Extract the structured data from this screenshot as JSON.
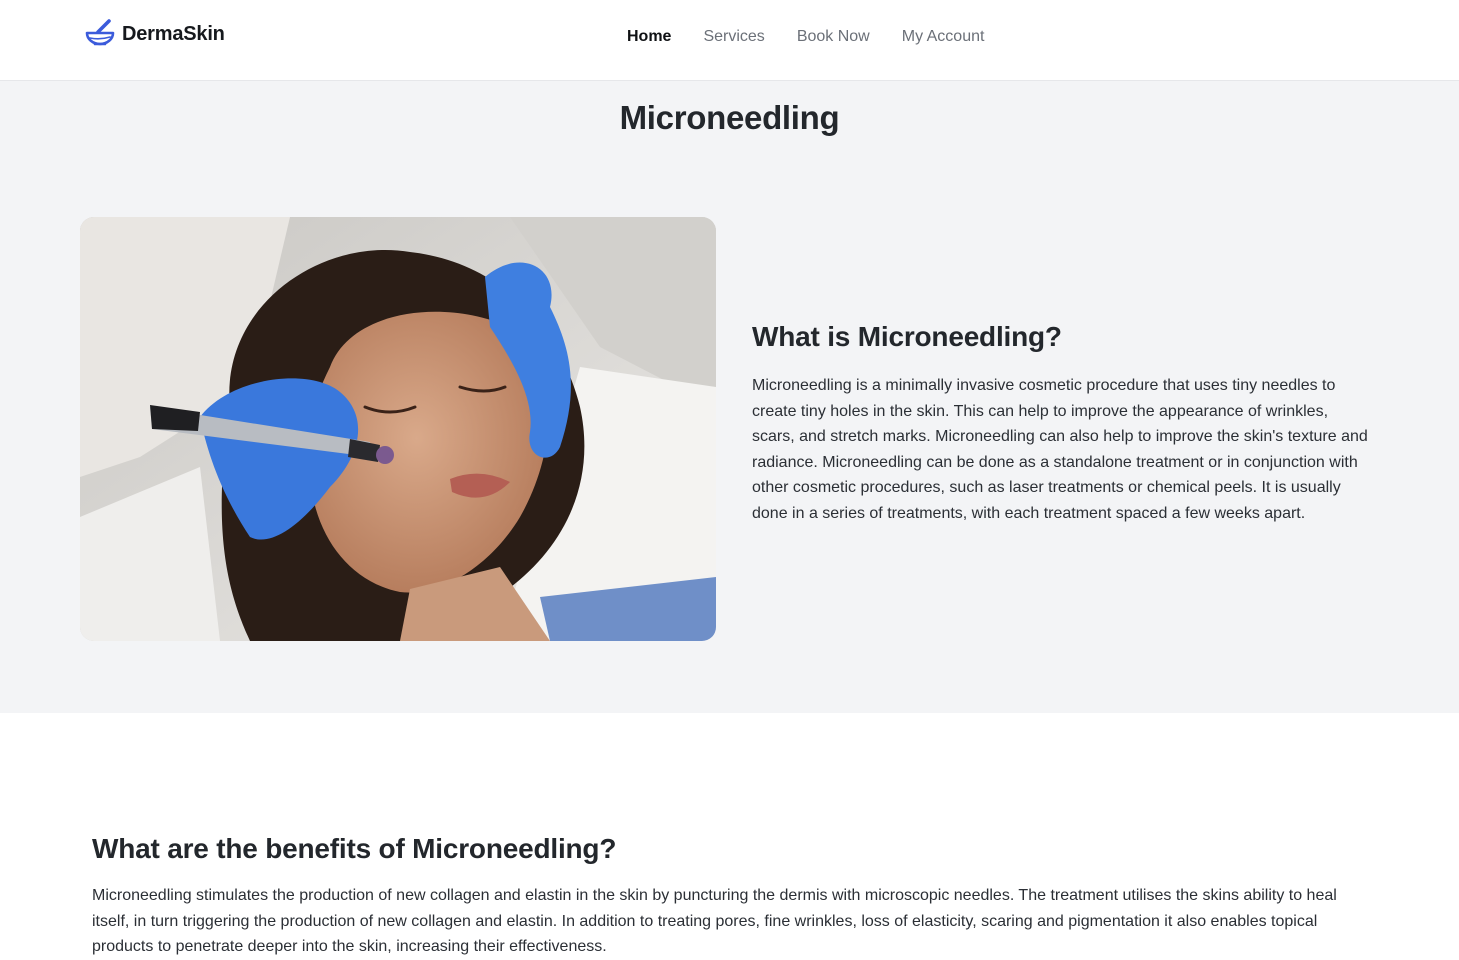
{
  "brand": {
    "name": "DermaSkin",
    "icon": "mortar-pestle-icon",
    "accent_color": "#3b5bdb"
  },
  "nav": {
    "items": [
      {
        "label": "Home",
        "active": true
      },
      {
        "label": "Services",
        "active": false
      },
      {
        "label": "Book Now",
        "active": false
      },
      {
        "label": "My Account",
        "active": false
      }
    ]
  },
  "page": {
    "title": "Microneedling"
  },
  "intro": {
    "image_subject": "Woman receiving microneedling facial treatment from gloved hands",
    "heading": "What is Microneedling?",
    "body": "Microneedling is a minimally invasive cosmetic procedure that uses tiny needles to create tiny holes in the skin. This can help to improve the appearance of wrinkles, scars, and stretch marks. Microneedling can also help to improve the skin's texture and radiance. Microneedling can be done as a standalone treatment or in conjunction with other cosmetic procedures, such as laser treatments or chemical peels. It is usually done in a series of treatments, with each treatment spaced a few weeks apart."
  },
  "benefits": {
    "heading": "What are the benefits of Microneedling?",
    "body": "Microneedling stimulates the production of new collagen and elastin in the skin by puncturing the dermis with microscopic needles. The treatment utilises the skins ability to heal itself, in turn triggering the production of new collagen and elastin. In addition to treating pores, fine wrinkles, loss of elasticity, scaring and pigmentation it also enables topical products to penetrate deeper into the skin, increasing their effectiveness."
  }
}
